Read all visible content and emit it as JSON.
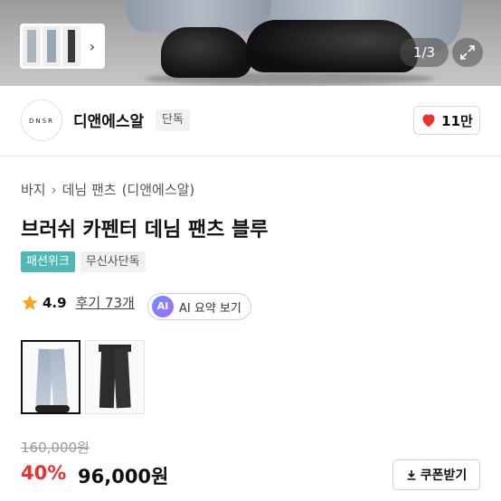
{
  "gallery": {
    "counter": "1/3",
    "chevron": "›",
    "expand_icon": "expand-icon"
  },
  "brand": {
    "logo_text": "DNSR",
    "name": "디앤에스알",
    "badge": "단독",
    "likes": "11만",
    "heart_color": "#e8332d"
  },
  "breadcrumb": {
    "items": [
      "바지",
      "데님 팬츠",
      "(디앤에스알)"
    ],
    "separator": "›"
  },
  "product": {
    "title": "브러쉬 카펜터 데님 팬츠 블루",
    "tags": [
      "패션위크",
      "무신사단독"
    ],
    "tag_colors": [
      "#4fb8b4",
      "#f0f0f0"
    ],
    "rating": "4.9",
    "reviews": "후기 73개",
    "ai_badge": "AI",
    "ai_label": "AI 요약 보기",
    "color_options": [
      "blue",
      "black"
    ]
  },
  "pricing": {
    "original": "160,000원",
    "discount": "40%",
    "price": "96,000원",
    "coupon_label": "쿠폰받기",
    "discount_color": "#e8332d"
  }
}
